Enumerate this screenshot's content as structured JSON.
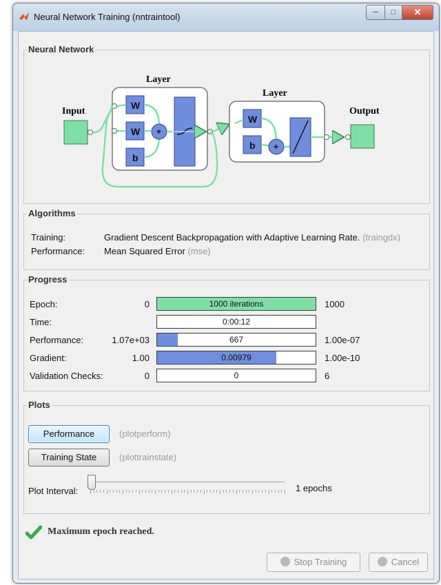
{
  "window": {
    "title": "Neural Network Training (nntraintool)"
  },
  "network": {
    "section_label": "Neural Network",
    "input_label": "Input",
    "output_label": "Output",
    "layer1_label": "Layer",
    "layer2_label": "Layer",
    "weight_label": "W",
    "bias_label": "b",
    "sum_symbol": "+"
  },
  "algorithms": {
    "section_label": "Algorithms",
    "training_key": "Training:",
    "training_value": "Gradient Descent Backpropagation with Adaptive Learning Rate.",
    "training_code": "(traingdx)",
    "performance_key": "Performance:",
    "performance_value": "Mean Squared Error",
    "performance_code": "(mse)"
  },
  "progress": {
    "section_label": "Progress",
    "rows": [
      {
        "label": "Epoch:",
        "start": "0",
        "value_text": "1000 iterations",
        "end": "1000",
        "fill_fraction": 1.0,
        "fill_color": "#7fe0a6"
      },
      {
        "label": "Time:",
        "start": "",
        "value_text": "0:00:12",
        "end": "",
        "fill_fraction": 0,
        "fill_color": "#ffffff"
      },
      {
        "label": "Performance:",
        "start": "1.07e+03",
        "value_text": "667",
        "end": "1.00e-07",
        "fill_fraction": 0.13,
        "fill_color": "#6f8ee0"
      },
      {
        "label": "Gradient:",
        "start": "1.00",
        "value_text": "0.00979",
        "end": "1.00e-10",
        "fill_fraction": 0.75,
        "fill_color": "#6f8ee0"
      },
      {
        "label": "Validation Checks:",
        "start": "0",
        "value_text": "0",
        "end": "6",
        "fill_fraction": 0,
        "fill_color": "#ffffff"
      }
    ]
  },
  "plots": {
    "section_label": "Plots",
    "performance_button": "Performance",
    "performance_hint": "(plotperform)",
    "training_state_button": "Training State",
    "training_state_hint": "(plottrainstate)",
    "interval_label": "Plot Interval:",
    "interval_value": "1 epochs",
    "interval_slider_fraction": 0.0
  },
  "status": {
    "message": "Maximum epoch reached.",
    "icon": "checkmark-icon"
  },
  "footer": {
    "stop_button": "Stop Training",
    "cancel_button": "Cancel"
  },
  "colors": {
    "accent_green": "#7fe0a6",
    "accent_blue": "#6f8ee0",
    "check_green": "#3aa84a"
  }
}
